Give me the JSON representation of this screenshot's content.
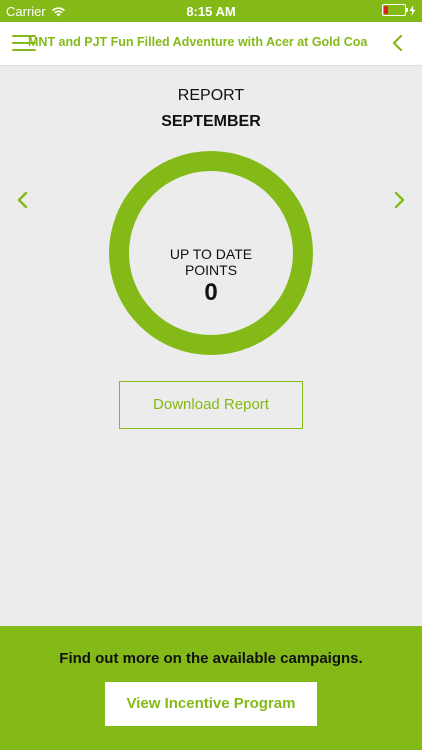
{
  "status_bar": {
    "carrier": "Carrier",
    "time": "8:15 AM",
    "battery_level": 0.2,
    "icons": [
      "wifi-icon",
      "battery-icon",
      "charging-icon"
    ]
  },
  "navbar": {
    "title": "MNT and PJT Fun Filled Adventure with Acer at Gold Coast",
    "menu_icon": "hamburger-menu-icon",
    "back_icon": "chevron-left-icon"
  },
  "report": {
    "heading": "REPORT",
    "month": "SEPTEMBER",
    "points_label_line1": "UP TO DATE",
    "points_label_line2": "POINTS",
    "points_value": "0",
    "prev_icon": "chevron-left-icon",
    "next_icon": "chevron-right-icon",
    "download_label": "Download Report"
  },
  "footer": {
    "text": "Find out more on the available campaigns.",
    "button_label": "View Incentive Program"
  },
  "colors": {
    "accent": "#84ba17",
    "background": "#ececec",
    "battery_low": "#e02020"
  }
}
